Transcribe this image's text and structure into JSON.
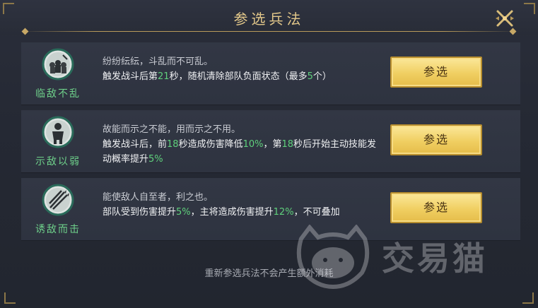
{
  "dialog": {
    "title": "参选兵法",
    "footer_note": "重新参选兵法不会产生额外消耗"
  },
  "skills": [
    {
      "name": "临敌不乱",
      "quote": "纷纷纭纭，斗乱而不可乱。",
      "desc_parts": [
        "触发战斗后第",
        "21",
        "秒，随机清除部队负面状态（最多",
        "5",
        "个）"
      ],
      "button_label": "参选"
    },
    {
      "name": "示敌以弱",
      "quote": "故能而示之不能，用而示之不用。",
      "desc_parts": [
        "触发战斗后，前",
        "18",
        "秒造成伤害降低",
        "10%",
        "，第",
        "18",
        "秒后开始主动技能发动概率提升",
        "5%",
        ""
      ],
      "button_label": "参选"
    },
    {
      "name": "诱敌而击",
      "quote": "能使敌人自至者，利之也。",
      "desc_parts": [
        "部队受到伤害提升",
        "5%",
        "，主将造成伤害提升",
        "12%",
        "，不可叠加"
      ],
      "button_label": "参选"
    }
  ],
  "watermark": {
    "text": "交易猫"
  },
  "colors": {
    "accent_gold": "#e3c88a",
    "highlight_green": "#5fd07c",
    "button_gold": "#f0cf62"
  }
}
